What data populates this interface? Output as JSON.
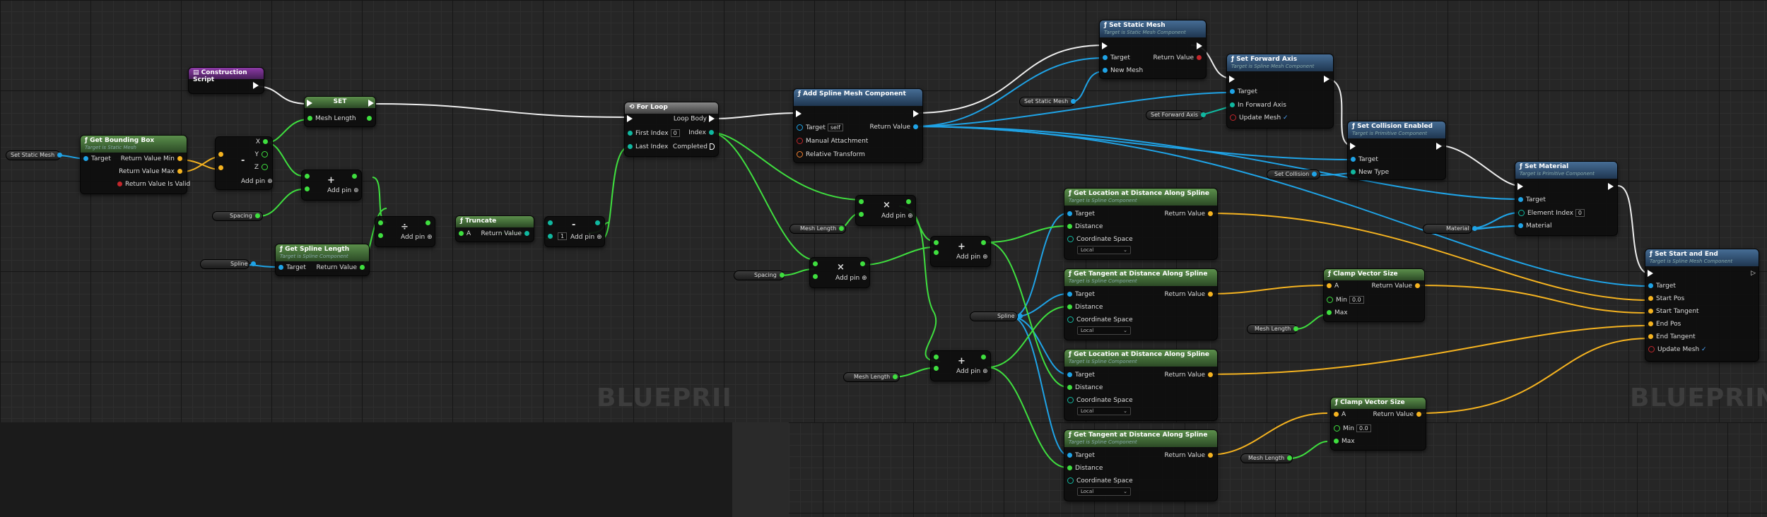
{
  "watermark": "BLUEPRINT",
  "watermark_clipped": "BLUEPRII",
  "construction_script": {
    "title": "Construction Script"
  },
  "set_node": {
    "title": "SET",
    "pin_mesh_length": "Mesh Length"
  },
  "get_bounding_box": {
    "title": "Get Bounding Box",
    "subtitle": "Target is Static Mesh",
    "target": "Target",
    "min": "Return Value Min",
    "max": "Return Value Max",
    "valid": "Return Value Is Valid"
  },
  "var_set_static_mesh": "Set Static Mesh",
  "subtract_vec": {
    "op": "-",
    "x": "X",
    "y": "Y",
    "z": "Z",
    "add_pin": "Add pin"
  },
  "add_node_1": {
    "op": "+",
    "add_pin": "Add pin"
  },
  "var_spacing": "Spacing",
  "get_spline_length": {
    "title": "Get Spline Length",
    "subtitle": "Target is Spline Component",
    "target": "Target",
    "ret": "Return Value"
  },
  "var_spline": "Spline",
  "div_node": {
    "op": "÷",
    "add_pin": "Add pin"
  },
  "truncate": {
    "title": "Truncate",
    "a": "A",
    "ret": "Return Value"
  },
  "minus_one": {
    "op": "-",
    "value": "1",
    "add_pin": "Add pin"
  },
  "for_loop": {
    "title": "For Loop",
    "loop_body": "Loop Body",
    "first_index": "First Index",
    "first_index_val": "0",
    "last_index": "Last Index",
    "index": "Index",
    "completed": "Completed"
  },
  "add_spline_mesh": {
    "title": "Add Spline Mesh Component",
    "target": "Target",
    "target_val": "self",
    "ret": "Return Value",
    "manual": "Manual Attachment",
    "relative": "Relative Transform"
  },
  "var_mesh_length": "Mesh Length",
  "mul_node_1": {
    "op": "×",
    "add_pin": "Add pin"
  },
  "mul_node_2": {
    "op": "×",
    "add_pin": "Add pin"
  },
  "add_node_2": {
    "op": "+",
    "add_pin": "Add pin"
  },
  "add_node_3": {
    "op": "+",
    "add_pin": "Add pin"
  },
  "set_static_mesh": {
    "title": "Set Static Mesh",
    "subtitle": "Target is Static Mesh Component",
    "target": "Target",
    "new_mesh": "New Mesh",
    "ret": "Return Value"
  },
  "set_forward_axis": {
    "title": "Set Forward Axis",
    "subtitle": "Target is Spline Mesh Component",
    "target": "Target",
    "in_axis": "In Forward Axis",
    "update": "Update Mesh"
  },
  "var_set_forward_axis": "Set Forward Axis",
  "set_collision": {
    "title": "Set Collision Enabled",
    "subtitle": "Target is Primitive Component",
    "target": "Target",
    "new_type": "New Type"
  },
  "var_set_collision": "Set Collision",
  "set_material": {
    "title": "Set Material",
    "subtitle": "Target is Primitive Component",
    "target": "Target",
    "element_index": "Element Index",
    "element_index_val": "0",
    "material": "Material"
  },
  "var_material": "Material",
  "set_start_end": {
    "title": "Set Start and End",
    "subtitle": "Target is Spline Mesh Component",
    "target": "Target",
    "start_pos": "Start Pos",
    "start_tangent": "Start Tangent",
    "end_pos": "End Pos",
    "end_tangent": "End Tangent",
    "update": "Update Mesh"
  },
  "loc_1": {
    "title": "Get Location at Distance Along Spline",
    "subtitle": "Target is Spline Component",
    "target": "Target",
    "distance": "Distance",
    "coord": "Coordinate Space",
    "coord_val": "Local",
    "ret": "Return Value"
  },
  "tan_1": {
    "title": "Get Tangent at Distance Along Spline",
    "subtitle": "Target is Spline Component",
    "target": "Target",
    "distance": "Distance",
    "coord": "Coordinate Space",
    "coord_val": "Local",
    "ret": "Return Value"
  },
  "loc_2": {
    "title": "Get Location at Distance Along Spline",
    "subtitle": "Target is Spline Component",
    "target": "Target",
    "distance": "Distance",
    "coord": "Coordinate Space",
    "coord_val": "Local",
    "ret": "Return Value"
  },
  "tan_2": {
    "title": "Get Tangent at Distance Along Spline",
    "subtitle": "Target is Spline Component",
    "target": "Target",
    "distance": "Distance",
    "coord": "Coordinate Space",
    "coord_val": "Local",
    "ret": "Return Value"
  },
  "clamp_1": {
    "title": "Clamp Vector Size",
    "a": "A",
    "min": "Min",
    "min_val": "0.0",
    "max": "Max",
    "ret": "Return Value"
  },
  "clamp_2": {
    "title": "Clamp Vector Size",
    "a": "A",
    "min": "Min",
    "min_val": "0.0",
    "max": "Max",
    "ret": "Return Value"
  },
  "colors": {
    "exec": "#ffffff",
    "object": "#1fa3e6",
    "vector": "#f5b320",
    "float": "#3fdf3f",
    "int": "#10b8a0"
  }
}
